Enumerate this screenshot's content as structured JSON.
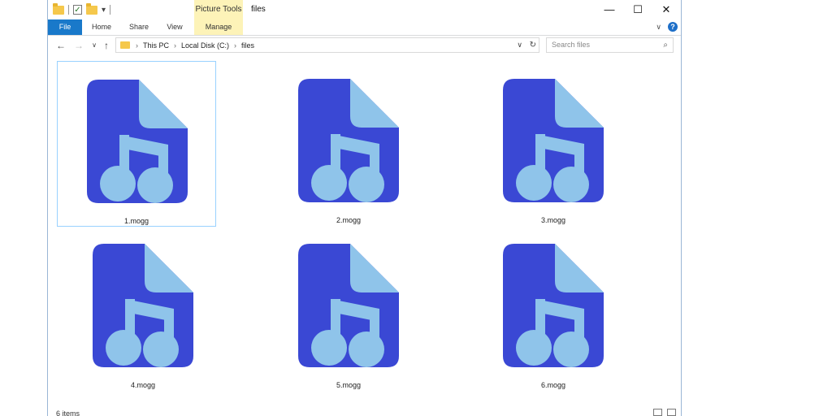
{
  "window": {
    "title": "files",
    "contextual_tab": "Picture Tools",
    "controls": {
      "minimize": "—",
      "maximize": "☐",
      "close": "✕"
    }
  },
  "ribbon": {
    "tabs": [
      "File",
      "Home",
      "Share",
      "View",
      "Manage"
    ]
  },
  "address": {
    "crumbs": [
      "This PC",
      "Local Disk (C:)",
      "files"
    ],
    "search_placeholder": "Search files"
  },
  "files": [
    {
      "name": "1.mogg",
      "selected": true
    },
    {
      "name": "2.mogg",
      "selected": false
    },
    {
      "name": "3.mogg",
      "selected": false
    },
    {
      "name": "4.mogg",
      "selected": false
    },
    {
      "name": "5.mogg",
      "selected": false
    },
    {
      "name": "6.mogg",
      "selected": false
    }
  ],
  "status": {
    "item_count": "6 items"
  },
  "colors": {
    "file_body": "#3a48d4",
    "file_fold": "#8fc4ea",
    "note": "#8fc4ea",
    "accent": "#1979ca"
  }
}
